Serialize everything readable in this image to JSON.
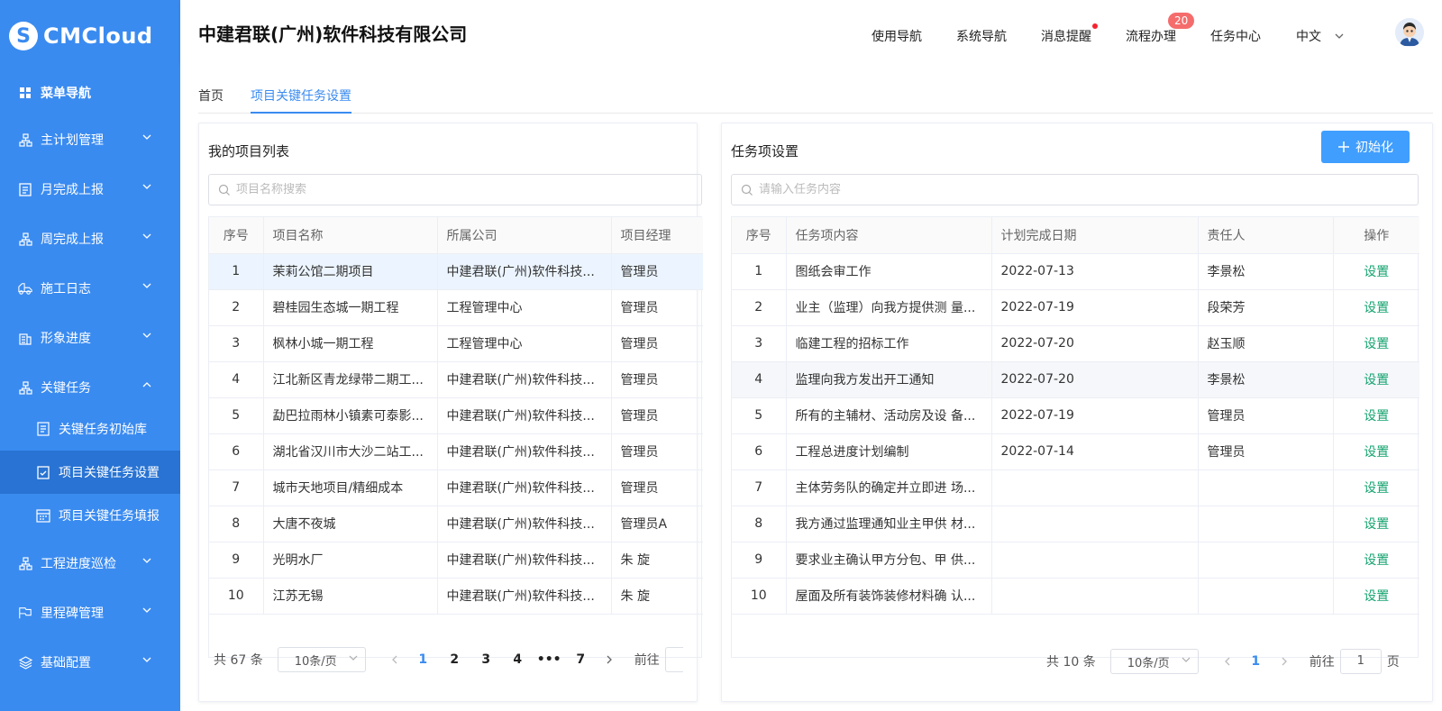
{
  "logo": {
    "mark": "S",
    "name": "CMCloud"
  },
  "sidebar": {
    "items": [
      {
        "label": "菜单导航",
        "icon": "grid-icon"
      },
      {
        "label": "主计划管理",
        "icon": "org-icon"
      },
      {
        "label": "月完成上报",
        "icon": "clipboard-icon"
      },
      {
        "label": "周完成上报",
        "icon": "org-icon"
      },
      {
        "label": "施工日志",
        "icon": "truck-icon"
      },
      {
        "label": "形象进度",
        "icon": "building-icon"
      },
      {
        "label": "关键任务",
        "icon": "org-icon"
      },
      {
        "label": "关键任务初始库",
        "icon": "document-icon"
      },
      {
        "label": "项目关键任务设置",
        "icon": "checklist-icon"
      },
      {
        "label": "项目关键任务填报",
        "icon": "calendar-icon"
      },
      {
        "label": "工程进度巡检",
        "icon": "org-icon"
      },
      {
        "label": "里程碑管理",
        "icon": "flag-icon"
      },
      {
        "label": "基础配置",
        "icon": "layers-icon"
      }
    ]
  },
  "header": {
    "company": "中建君联(广州)软件科技有限公司",
    "nav": [
      "使用导航",
      "系统导航",
      "消息提醒",
      "流程办理",
      "任务中心",
      "中文"
    ],
    "badge_count": "20"
  },
  "tabs": [
    "首页",
    "项目关键任务设置"
  ],
  "projects": {
    "title": "我的项目列表",
    "search_placeholder": "项目名称搜索",
    "columns": [
      "序号",
      "项目名称",
      "所属公司",
      "项目经理"
    ],
    "rows": [
      [
        "1",
        "茉莉公馆二期项目",
        "中建君联(广州)软件科技...",
        "管理员"
      ],
      [
        "2",
        "碧桂园生态城一期工程",
        "工程管理中心",
        "管理员"
      ],
      [
        "3",
        "枫林小城一期工程",
        "工程管理中心",
        "管理员"
      ],
      [
        "4",
        "江北新区青龙绿带二期工...",
        "中建君联(广州)软件科技...",
        "管理员"
      ],
      [
        "5",
        "勐巴拉雨林小镇素可泰影...",
        "中建君联(广州)软件科技...",
        "管理员"
      ],
      [
        "6",
        "湖北省汉川市大沙二站工...",
        "中建君联(广州)软件科技...",
        "管理员"
      ],
      [
        "7",
        "城市天地项目/精细成本",
        "中建君联(广州)软件科技...",
        "管理员"
      ],
      [
        "8",
        "大唐不夜城",
        "中建君联(广州)软件科技...",
        "管理员A"
      ],
      [
        "9",
        "光明水厂",
        "中建君联(广州)软件科技...",
        "朱 旋"
      ],
      [
        "10",
        "江苏无锡",
        "中建君联(广州)软件科技...",
        "朱 旋"
      ]
    ],
    "pager": {
      "total": "共 67 条",
      "size": "10条/页",
      "pages": [
        "1",
        "2",
        "3",
        "4",
        "•••",
        "7"
      ],
      "goto": "前往"
    }
  },
  "tasks": {
    "title": "任务项设置",
    "init_button": "初始化",
    "search_placeholder": "请输入任务内容",
    "columns": [
      "序号",
      "任务项内容",
      "计划完成日期",
      "责任人",
      "操作"
    ],
    "rows": [
      [
        "1",
        "图纸会审工作",
        "2022-07-13",
        "李景松",
        "设置"
      ],
      [
        "2",
        "业主（监理）向我方提供测 量...",
        "2022-07-19",
        "段荣芳",
        "设置"
      ],
      [
        "3",
        "临建工程的招标工作",
        "2022-07-20",
        "赵玉顺",
        "设置"
      ],
      [
        "4",
        "监理向我方发出开工通知",
        "2022-07-20",
        "李景松",
        "设置"
      ],
      [
        "5",
        "所有的主辅材、活动房及设 备...",
        "2022-07-19",
        "管理员",
        "设置"
      ],
      [
        "6",
        "工程总进度计划编制",
        "2022-07-14",
        "管理员",
        "设置"
      ],
      [
        "7",
        "主体劳务队的确定并立即进 场...",
        "",
        "",
        "设置"
      ],
      [
        "8",
        "我方通过监理通知业主甲供 材...",
        "",
        "",
        "设置"
      ],
      [
        "9",
        "要求业主确认甲方分包、甲 供...",
        "",
        "",
        "设置"
      ],
      [
        "10",
        "屋面及所有装饰装修材料确 认...",
        "",
        "",
        "设置"
      ]
    ],
    "pager": {
      "total": "共 10 条",
      "size": "10条/页",
      "current": "1",
      "goto": "前往",
      "goto_value": "1",
      "page_unit": "页"
    }
  }
}
